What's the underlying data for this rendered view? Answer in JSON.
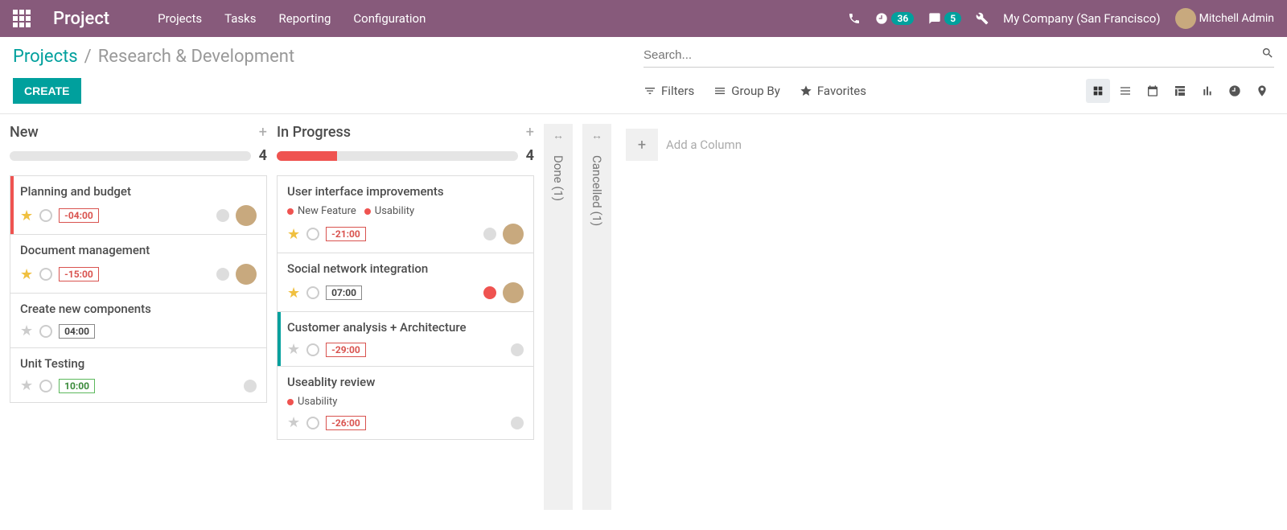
{
  "topbar": {
    "brand": "Project",
    "nav": [
      "Projects",
      "Tasks",
      "Reporting",
      "Configuration"
    ],
    "activity_count": "36",
    "message_count": "5",
    "company": "My Company (San Francisco)",
    "user": "Mitchell Admin"
  },
  "breadcrumb": {
    "root": "Projects",
    "current": "Research & Development"
  },
  "buttons": {
    "create": "CREATE"
  },
  "search": {
    "placeholder": "Search..."
  },
  "filters": {
    "filters": "Filters",
    "groupby": "Group By",
    "favorites": "Favorites"
  },
  "add_column": "Add a Column",
  "columns": [
    {
      "title": "New",
      "count": "4",
      "progress_red_pct": 0,
      "cards": [
        {
          "title": "Planning and budget",
          "starred": true,
          "time": "-04:00",
          "time_cls": "time-neg",
          "leftbar": "#ef5350",
          "avatar": true,
          "status": "normal",
          "tags": []
        },
        {
          "title": "Document management",
          "starred": true,
          "time": "-15:00",
          "time_cls": "time-neg",
          "leftbar": "",
          "avatar": true,
          "status": "normal",
          "tags": []
        },
        {
          "title": "Create new components",
          "starred": false,
          "time": "04:00",
          "time_cls": "time-pos",
          "leftbar": "",
          "avatar": false,
          "status": "none",
          "tags": []
        },
        {
          "title": "Unit Testing",
          "starred": false,
          "time": "10:00",
          "time_cls": "time-green",
          "leftbar": "",
          "avatar": false,
          "status": "normal",
          "tags": []
        }
      ]
    },
    {
      "title": "In Progress",
      "count": "4",
      "progress_red_pct": 25,
      "cards": [
        {
          "title": "User interface improvements",
          "starred": true,
          "time": "-21:00",
          "time_cls": "time-neg",
          "leftbar": "",
          "avatar": true,
          "status": "normal",
          "tags": [
            {
              "label": "New Feature",
              "color": "#ef5350"
            },
            {
              "label": "Usability",
              "color": "#ef5350"
            }
          ]
        },
        {
          "title": "Social network integration",
          "starred": true,
          "time": "07:00",
          "time_cls": "time-pos",
          "leftbar": "",
          "avatar": true,
          "status": "blocked",
          "tags": []
        },
        {
          "title": "Customer analysis + Architecture",
          "starred": false,
          "time": "-29:00",
          "time_cls": "time-neg",
          "leftbar": "#00a09d",
          "avatar": false,
          "status": "normal",
          "tags": []
        },
        {
          "title": "Useablity review",
          "starred": false,
          "time": "-26:00",
          "time_cls": "time-neg",
          "leftbar": "",
          "avatar": false,
          "status": "normal",
          "tags": [
            {
              "label": "Usability",
              "color": "#ef5350"
            }
          ]
        }
      ]
    }
  ],
  "folded": [
    {
      "title": "Done (1)"
    },
    {
      "title": "Cancelled (1)"
    }
  ]
}
